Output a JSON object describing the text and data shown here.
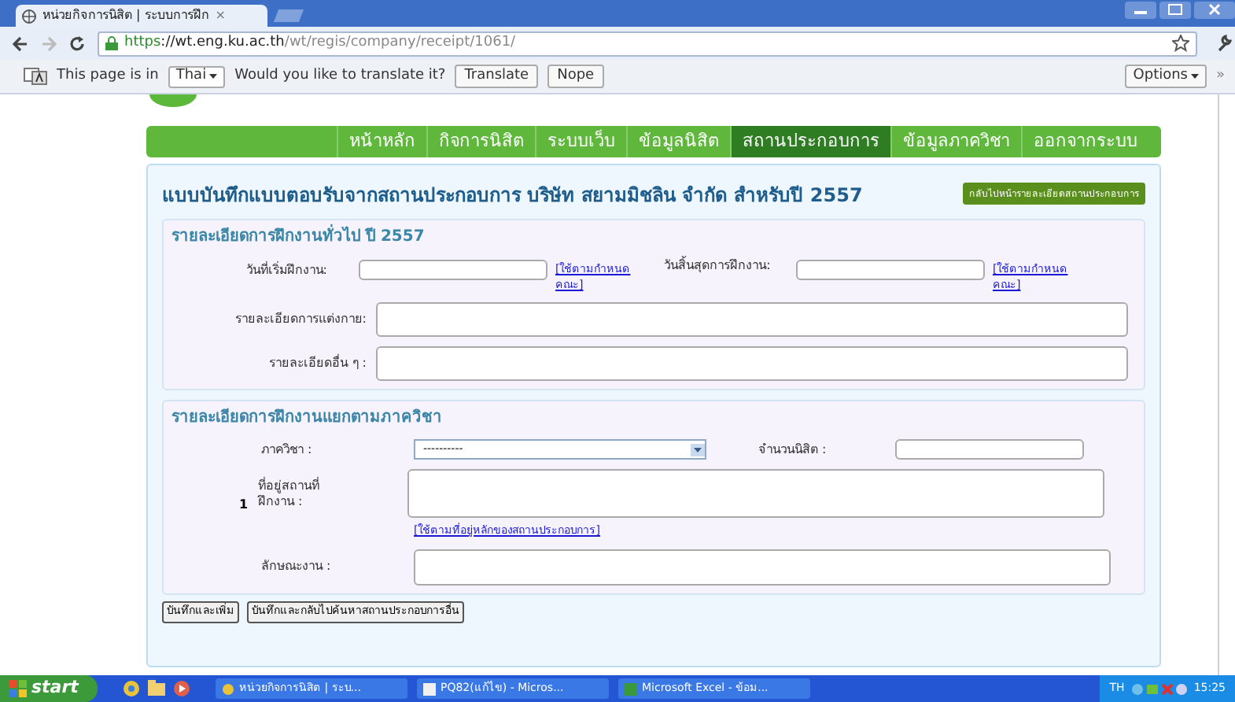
{
  "browser": {
    "tab_title": "หน่วยกิจการนิสิต | ระบบการฝึก",
    "tab_close": "×",
    "url_scheme": "https",
    "url_host": "://wt.eng.ku.ac.th",
    "url_path": "/wt/regis/company/receipt/1061/"
  },
  "translate_bar": {
    "message": "This page is in",
    "language": "Thai",
    "question": "Would you like to translate it?",
    "buttons": [
      "Translate",
      "Nope"
    ],
    "options": "Options",
    "more": "»"
  },
  "nav": [
    {
      "label": "หน้าหลัก",
      "selected": false
    },
    {
      "label": "กิจการนิสิต",
      "selected": false
    },
    {
      "label": "ระบบเว็บ",
      "selected": false
    },
    {
      "label": "ข้อมูลนิสิต",
      "selected": false
    },
    {
      "label": "สถานประกอบการ",
      "selected": true
    },
    {
      "label": "ข้อมูลภาควิชา",
      "selected": false
    },
    {
      "label": "ออกจากระบบ",
      "selected": false
    }
  ],
  "form": {
    "title": "แบบบันทึกแบบตอบรับจากสถานประกอบการ บริษัท สยามมิชลิน จำกัด สำหรับปี 2557",
    "back_button": "กลับไปหน้ารายละเอียดสถานประกอบการ",
    "sections": [
      {
        "title": "รายละเอียดการฝึกงานทั่วไป ปี 2557",
        "rows": [
          {
            "kind": "dates",
            "fields": [
              {
                "label": "วันที่เริ่มฝึกงาน:",
                "link": "[ใช้ตามกำหนดคณะ]"
              },
              {
                "label": "วันสิ้นสุดการฝึกงาน:",
                "link": "[ใช้ตามกำหนดคณะ]"
              }
            ]
          },
          {
            "kind": "textarea",
            "label": "รายละเอียดการแต่งกาย:"
          },
          {
            "kind": "textarea",
            "label": "รายละเอียดอื่น ๆ :"
          }
        ]
      },
      {
        "title": "รายละเอียดการฝึกงานแยกตามภาควิชา",
        "rows": [
          {
            "kind": "select",
            "label": "ภาควิชา :",
            "value": "----------",
            "count_label": "จำนวนนิสิต :"
          },
          {
            "kind": "address",
            "index": "1",
            "label": "ที่อยู่สถานที่ฝึกงาน :",
            "link": "[ใช้ตามที่อยู่หลักของสถานประกอบการ]"
          },
          {
            "kind": "task",
            "label": "ลักษณะงาน :"
          }
        ]
      }
    ],
    "buttons": [
      "บันทึกและเพิ่ม",
      "บันทึกและกลับไปค้นหาสถานประกอบการอื่น"
    ]
  },
  "taskbar": {
    "start": "start",
    "tasks": [
      "หน่วยกิจการนิสิต | ระบ...",
      "PQ82(แก้ไข) - Micros...",
      "Microsoft Excel - ข้อม..."
    ],
    "language": "TH",
    "time": "15:25"
  }
}
